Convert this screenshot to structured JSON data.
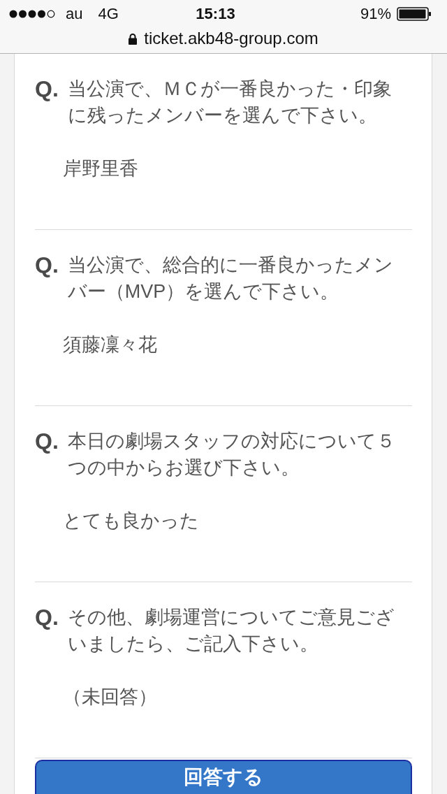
{
  "status_bar": {
    "carrier": "au",
    "network": "4G",
    "time": "15:13",
    "battery": "91%"
  },
  "address_bar": {
    "url": "ticket.akb48-group.com"
  },
  "survey": {
    "items": [
      {
        "marker": "Q.",
        "question": "当公演で、ＭＣが一番良かった・印象に残ったメンバーを選んで下さい。",
        "answer": "岸野里香"
      },
      {
        "marker": "Q.",
        "question": "当公演で、総合的に一番良かったメンバー（MVP）を選んで下さい。",
        "answer": "須藤凜々花"
      },
      {
        "marker": "Q.",
        "question": "本日の劇場スタッフの対応について５つの中からお選び下さい。",
        "answer": "とても良かった"
      },
      {
        "marker": "Q.",
        "question": "その他、劇場運営についてご意見ございましたら、ご記入下さい。",
        "answer": "（未回答）"
      }
    ],
    "submit_button": "回答する"
  }
}
